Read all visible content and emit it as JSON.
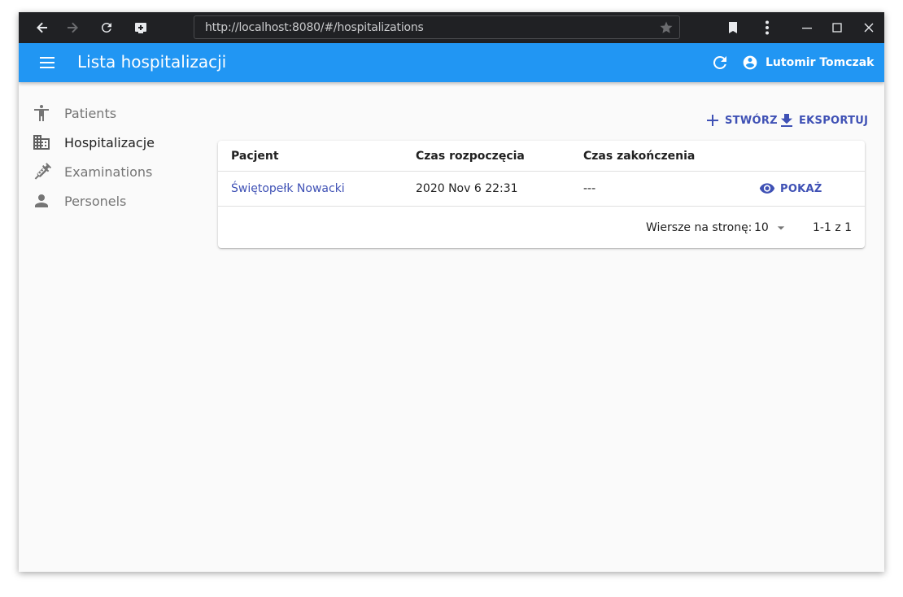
{
  "browser": {
    "url": "http://localhost:8080/#/hospitalizations"
  },
  "appbar": {
    "title": "Lista hospitalizacji",
    "user_name": "Lutomir Tomczak"
  },
  "sidebar": {
    "items": [
      {
        "label": "Patients",
        "icon": "accessibility-icon"
      },
      {
        "label": "Hospitalizacje",
        "icon": "hospital-building-icon"
      },
      {
        "label": "Examinations",
        "icon": "syringe-icon"
      },
      {
        "label": "Personels",
        "icon": "person-icon"
      }
    ]
  },
  "toolbar": {
    "create_label": "STWÓRZ",
    "export_label": "EKSPORTUJ"
  },
  "table": {
    "columns": [
      "Pacjent",
      "Czas rozpoczęcia",
      "Czas zakończenia"
    ],
    "rows": [
      {
        "patient": "Świętopełk Nowacki",
        "start": "2020 Nov 6 22:31",
        "end": "---",
        "action": "POKAŻ"
      }
    ]
  },
  "pagination": {
    "rows_per_page_label": "Wiersze na stronę:",
    "rows_per_page": "10",
    "range": "1-1 z 1"
  },
  "colors": {
    "appbar": "#2196f3",
    "accent": "#3f51b5",
    "chrome": "#202124"
  }
}
